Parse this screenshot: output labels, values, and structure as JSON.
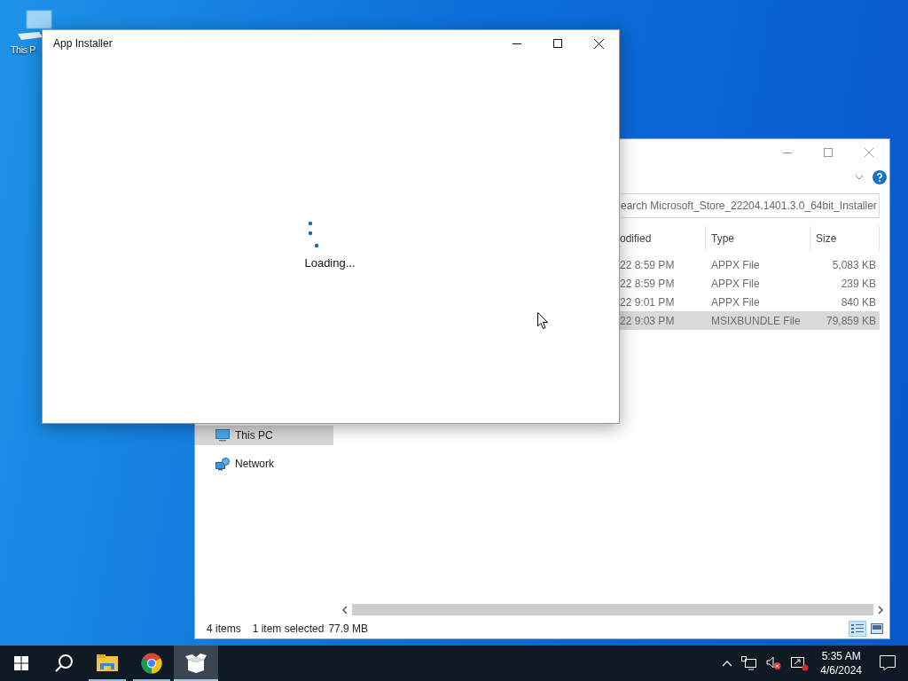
{
  "desktop": {
    "icons": [
      {
        "label": "This P"
      }
    ]
  },
  "explorer": {
    "search": {
      "placeholder": "earch Microsoft_Store_22204.1401.3.0_64bit_Installer"
    },
    "columns": [
      "odified",
      "Type",
      "Size"
    ],
    "rows": [
      {
        "modified": "22 8:59 PM",
        "type": "APPX File",
        "size": "5,083 KB",
        "selected": false
      },
      {
        "modified": "22 8:59 PM",
        "type": "APPX File",
        "size": "239 KB",
        "selected": false
      },
      {
        "modified": "22 9:01 PM",
        "type": "APPX File",
        "size": "840 KB",
        "selected": false
      },
      {
        "modified": "22 9:03 PM",
        "type": "MSIXBUNDLE File",
        "size": "79,859 KB",
        "selected": true
      }
    ],
    "nav": [
      {
        "label": "This PC",
        "kind": "pc",
        "selected": true
      },
      {
        "label": "Network",
        "kind": "network",
        "selected": false
      }
    ],
    "status": {
      "count": "4 items",
      "selection": "1 item selected",
      "size": "77.9 MB"
    },
    "views": [
      {
        "kind": "details",
        "selected": true
      },
      {
        "kind": "tiles",
        "selected": false
      }
    ]
  },
  "installer": {
    "title": "App Installer",
    "message": "Loading..."
  },
  "taskbar": {
    "apps": [
      {
        "kind": "explorer",
        "running": true,
        "active": false
      },
      {
        "kind": "chrome",
        "running": true,
        "active": false
      },
      {
        "kind": "installer",
        "running": true,
        "active": true
      }
    ],
    "clock": {
      "time": "5:35 AM",
      "date": "4/6/2024"
    }
  }
}
